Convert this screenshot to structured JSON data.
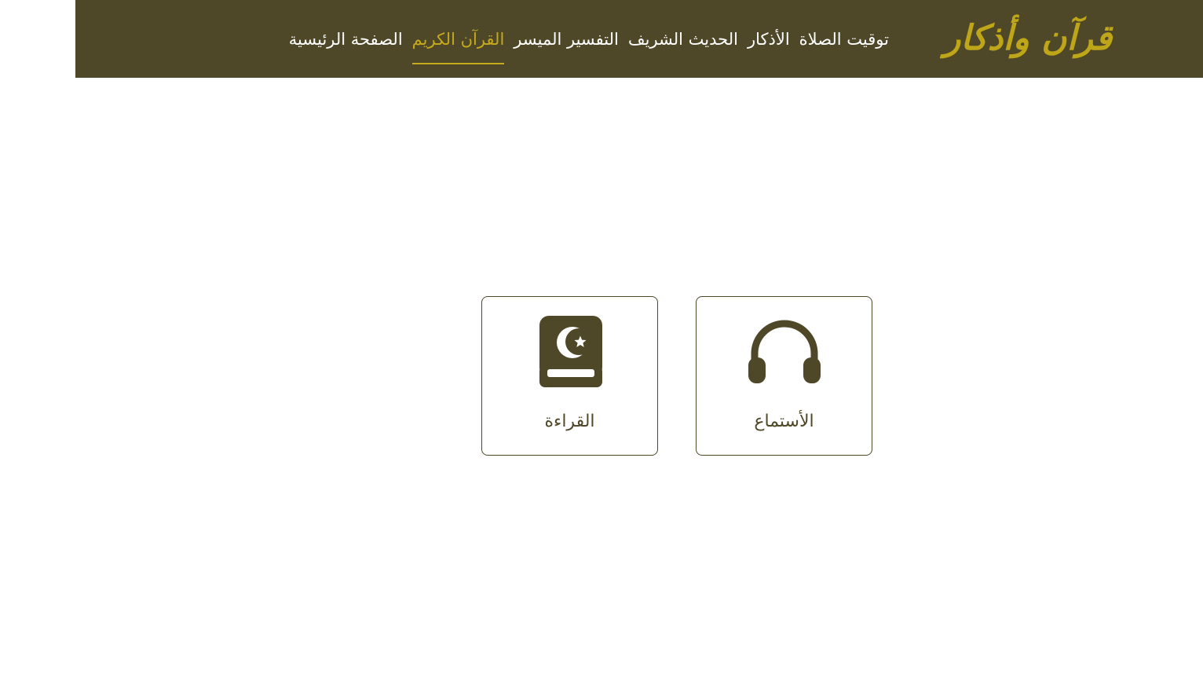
{
  "header": {
    "logo": "قرآن وأذكار",
    "nav": [
      {
        "label": "الصفحة الرئيسية",
        "active": false
      },
      {
        "label": "القرآن الكريم",
        "active": true
      },
      {
        "label": "التفسير الميسر",
        "active": false
      },
      {
        "label": "الحديث الشريف",
        "active": false
      },
      {
        "label": "الأذكار",
        "active": false
      },
      {
        "label": "توقيت الصلاة",
        "active": false
      }
    ]
  },
  "options": {
    "listen": {
      "label": "الأستماع",
      "icon": "headphones-icon"
    },
    "read": {
      "label": "القراءة",
      "icon": "quran-book-icon"
    }
  },
  "colors": {
    "brand": "#4e4828",
    "accent": "#c7aa1c",
    "nav_text": "#ffffff"
  }
}
